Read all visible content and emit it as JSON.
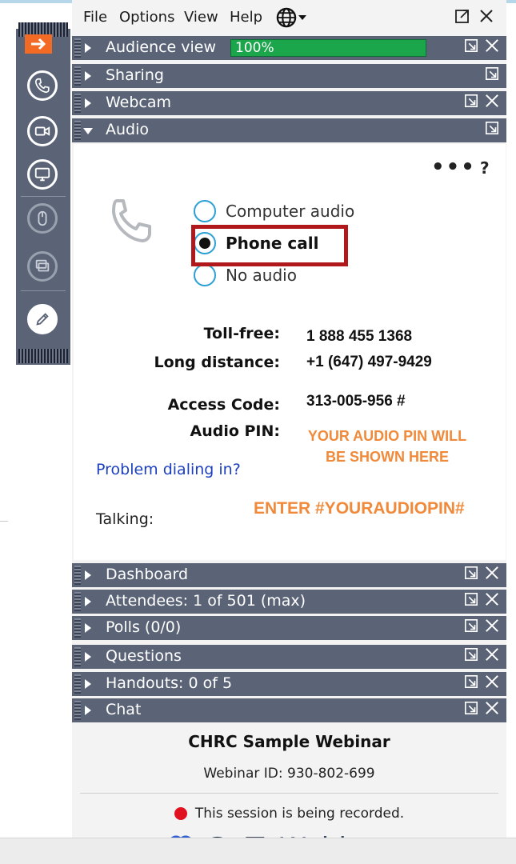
{
  "menu": {
    "file": "File",
    "options": "Options",
    "view": "View",
    "help": "Help"
  },
  "sections": {
    "audience_view": {
      "title": "Audience view",
      "progress_text": "100%",
      "progress": 1.0
    },
    "sharing": {
      "title": "Sharing"
    },
    "webcam": {
      "title": "Webcam"
    },
    "audio": {
      "title": "Audio"
    },
    "dashboard": {
      "title": "Dashboard"
    },
    "attendees": {
      "title": "Attendees:  1 of 501 (max)"
    },
    "polls": {
      "title": "Polls (0/0)"
    },
    "questions": {
      "title": "Questions"
    },
    "handouts": {
      "title": "Handouts: 0 of 5"
    },
    "chat": {
      "title": "Chat"
    }
  },
  "audio": {
    "more": "•••",
    "help": "?",
    "options": [
      "Computer audio",
      "Phone call",
      "No audio"
    ],
    "selected": "Phone call",
    "toll_free_label": "Toll-free:",
    "toll_free_value": "1 888 455 1368",
    "long_distance_label": "Long distance:",
    "long_distance_value": "+1 (647) 497-9429",
    "access_code_label": "Access Code:",
    "access_code_value": "313-005-956 #",
    "audio_pin_label": "Audio PIN:",
    "pin_note_line1": "YOUR AUDIO PIN WILL",
    "pin_note_line2": "BE SHOWN HERE",
    "problem_link": "Problem dialing in?",
    "enter_note": "ENTER #YOURAUDIOPIN#",
    "talking_label": "Talking:"
  },
  "footer": {
    "webinar_title": "CHRC Sample Webinar",
    "webinar_id": "Webinar ID: 930-802-699",
    "recording_text": "This session is being recorded.",
    "brand_bold": "GoTo",
    "brand_thin": "Webinar"
  },
  "colors": {
    "accent_orange": "#f26a23",
    "panel_header": "#5b6477",
    "highlight_red": "#b0181c",
    "note_orange": "#f08a3a",
    "progress_green": "#1ba64c"
  }
}
